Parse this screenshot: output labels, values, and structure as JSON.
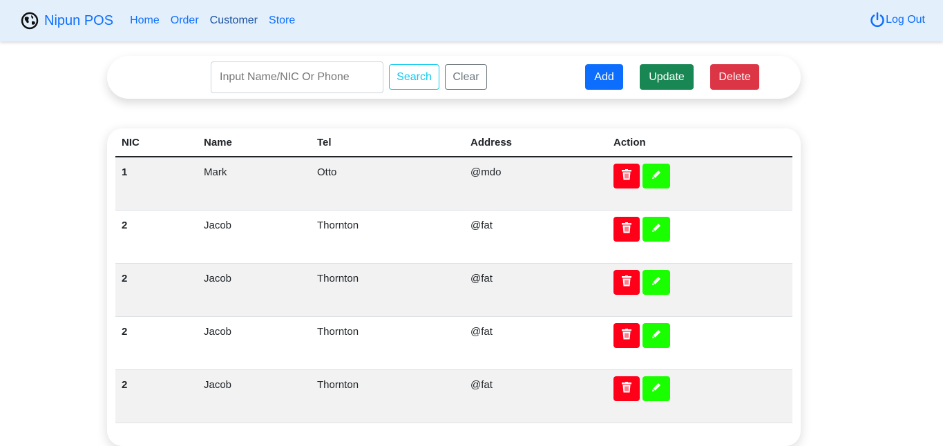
{
  "nav": {
    "brand": "Nipun POS",
    "links": [
      "Home",
      "Order",
      "Customer",
      "Store"
    ],
    "logout": "Log Out"
  },
  "toolbar": {
    "search_placeholder": "Input Name/NIC Or Phone",
    "search": "Search",
    "clear": "Clear",
    "add": "Add",
    "update": "Update",
    "delete": "Delete"
  },
  "table": {
    "headers": [
      "NIC",
      "Name",
      "Tel",
      "Address",
      "Action"
    ],
    "rows": [
      [
        "1",
        "Mark",
        "Otto",
        "@mdo"
      ],
      [
        "2",
        "Jacob",
        "Thornton",
        "@fat"
      ],
      [
        "2",
        "Jacob",
        "Thornton",
        "@fat"
      ],
      [
        "2",
        "Jacob",
        "Thornton",
        "@fat"
      ],
      [
        "2",
        "Jacob",
        "Thornton",
        "@fat"
      ]
    ]
  },
  "colors": {
    "primary": "#0d6efd",
    "success": "#198754",
    "danger": "#dc3545",
    "trash": "#ff0019",
    "edit": "#1aff00"
  }
}
